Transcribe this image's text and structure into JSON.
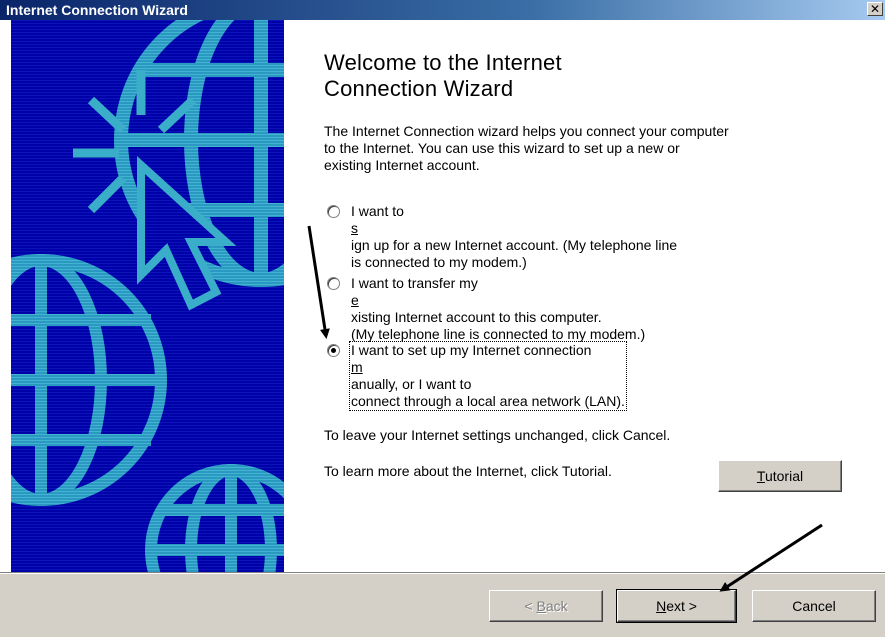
{
  "window": {
    "title": "Internet Connection Wizard",
    "close_glyph": "✕"
  },
  "heading": {
    "line1": "Welcome to the Internet",
    "line2": "Connection Wizard"
  },
  "intro": {
    "line1": "The Internet Connection wizard helps you connect your computer",
    "line2": "to the Internet.  You can use this wizard to set up a new or",
    "line3": "existing Internet account."
  },
  "options": [
    {
      "line1_before": "I want to ",
      "line1_mnemonic": "s",
      "line1_after": "ign up for a new Internet account. (My telephone line",
      "line2": "is connected to my modem.)",
      "checked": false
    },
    {
      "line1_before": "I want to transfer my ",
      "line1_mnemonic": "e",
      "line1_after": "xisting Internet account to this computer.",
      "line2": "(My telephone line is connected to my modem.)",
      "checked": false
    },
    {
      "line1_before": "I want to set up my Internet connection ",
      "line1_mnemonic": "m",
      "line1_after": "anually, or I want to",
      "line2": "connect through a local area network (LAN).",
      "checked": true
    }
  ],
  "cancel_hint": "To leave your Internet settings unchanged, click Cancel.",
  "tutorial_hint": "To learn more about the Internet, click Tutorial.",
  "buttons": {
    "tutorial_mnemonic": "T",
    "tutorial_rest": "utorial",
    "back_prefix": "< ",
    "back_mnemonic": "B",
    "back_rest": "ack",
    "next_mnemonic": "N",
    "next_rest": "ext >",
    "cancel": "Cancel"
  },
  "colors": {
    "panel_background": "#0000a0",
    "panel_pattern": "#20a0c0",
    "titlebar_start": "#0a246a",
    "face": "#d4d0c8"
  },
  "icons": {
    "close": "close-icon",
    "cursor_illustration": "mouse-pointer-icon",
    "globe": "globe-icon",
    "annotation_arrow": "arrow-icon"
  }
}
